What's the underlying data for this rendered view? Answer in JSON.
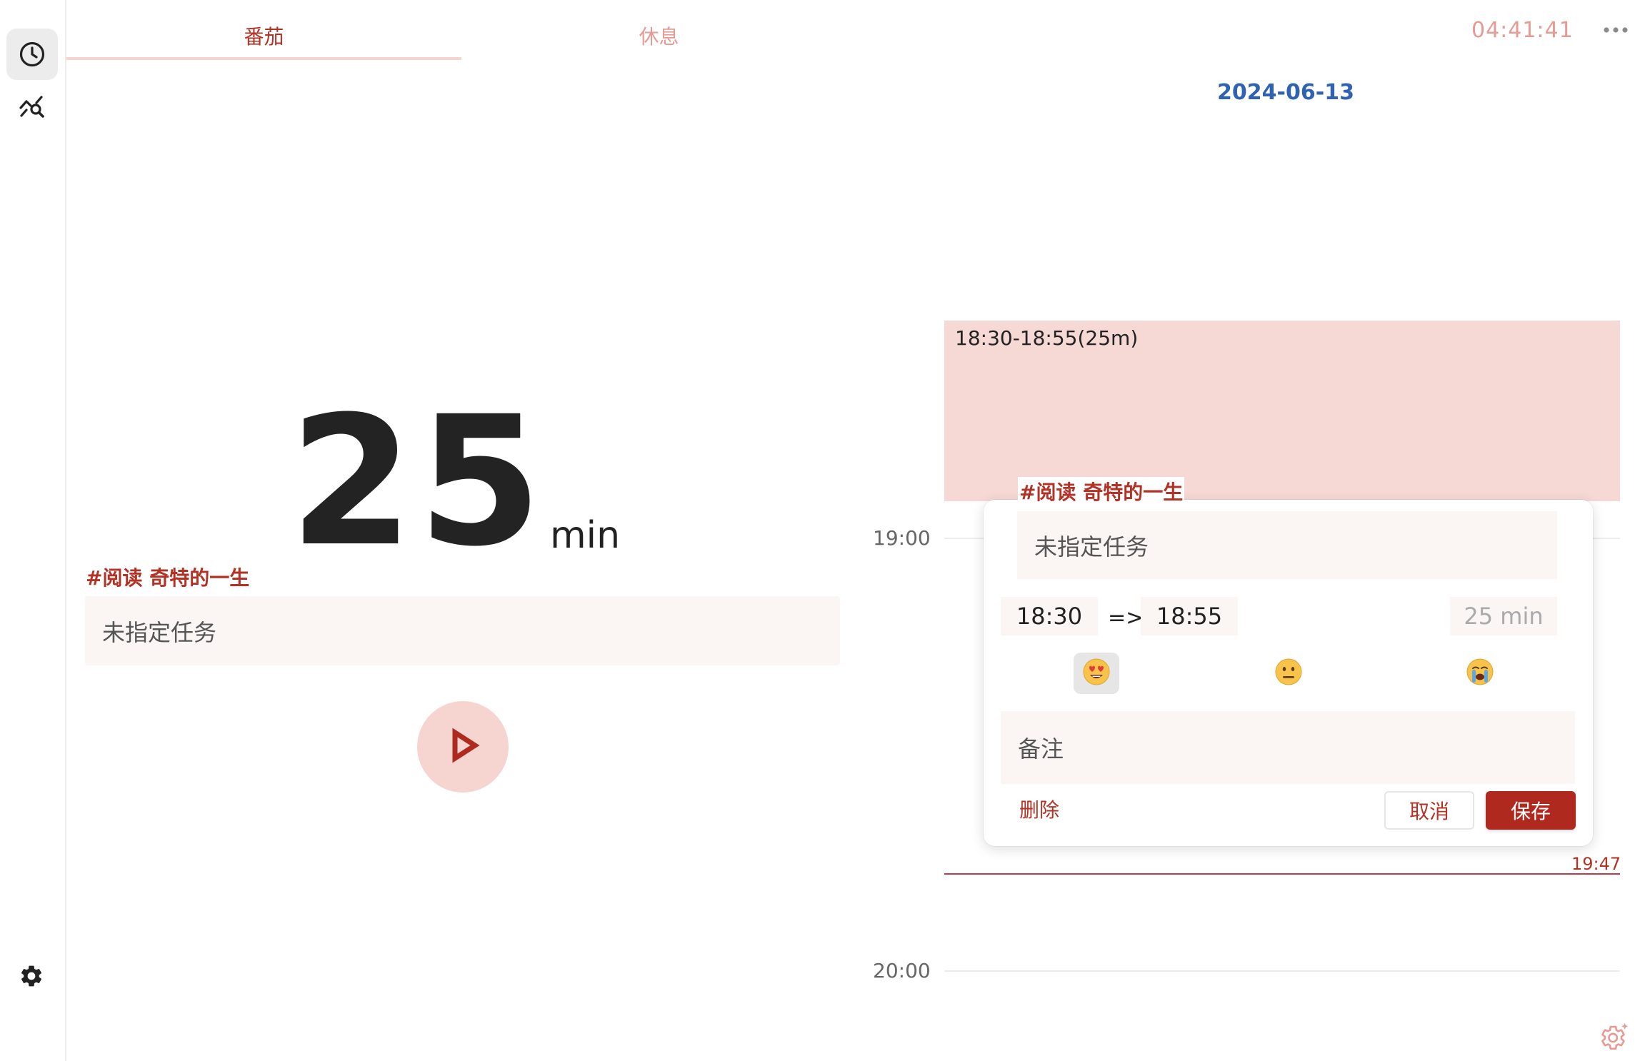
{
  "sidebar": {
    "items": [
      {
        "name": "timer",
        "icon": "clock-icon",
        "active": true
      },
      {
        "name": "statistics",
        "icon": "chart-search-icon",
        "active": false
      }
    ],
    "settings_icon": "gear-icon"
  },
  "tabs": [
    {
      "label": "番茄",
      "active": true
    },
    {
      "label": "休息",
      "active": false
    }
  ],
  "timer": {
    "minutes": "25",
    "unit": "min",
    "task_tag": "#阅读 奇特的一生",
    "task_placeholder": "未指定任务",
    "play_icon": "play-icon"
  },
  "header": {
    "clock": "04:41:41",
    "more_icon": "more-dots-icon",
    "date": "2024-06-13"
  },
  "timeline": {
    "hours": [
      "19:00",
      "20:00"
    ],
    "event": {
      "time_range": "18:30-18:55(25m)",
      "tag": "#阅读 奇特的一生"
    },
    "now": "19:47"
  },
  "editor": {
    "task_placeholder": "未指定任务",
    "start": "18:30",
    "arrow": "=>",
    "end": "18:55",
    "duration": "25 min",
    "moods": [
      {
        "emoji": "😍",
        "name": "love-emoji-icon",
        "selected": true
      },
      {
        "emoji": "😐",
        "name": "neutral-emoji-icon",
        "selected": false
      },
      {
        "emoji": "😭",
        "name": "crying-emoji-icon",
        "selected": false
      }
    ],
    "note_placeholder": "备注",
    "delete_label": "删除",
    "cancel_label": "取消",
    "save_label": "保存"
  },
  "colors": {
    "accent": "#b0291e",
    "accent_light": "#f6d4d0",
    "date_blue": "#2f62b3",
    "input_bg": "#fbf5f4"
  }
}
